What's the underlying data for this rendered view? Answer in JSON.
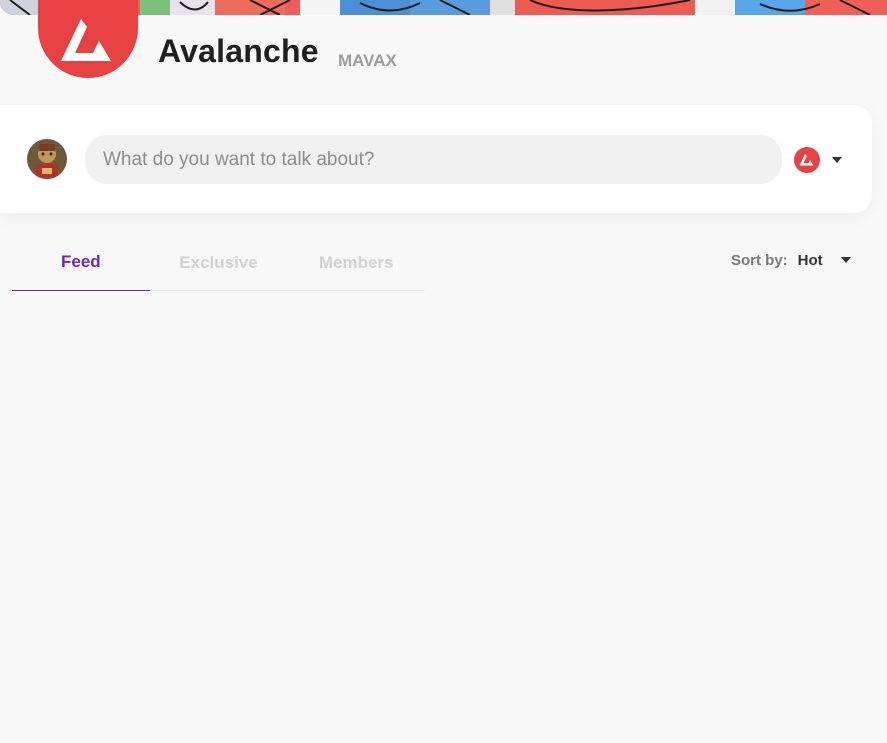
{
  "community": {
    "name": "Avalanche",
    "ticker": "MAVAX",
    "brand_color": "#e84142"
  },
  "composer": {
    "placeholder": "What do you want to talk about?",
    "avatar_icon": "user-avatar"
  },
  "tabs": [
    {
      "label": "Feed",
      "active": true
    },
    {
      "label": "Exclusive",
      "active": false
    },
    {
      "label": "Members",
      "active": false
    }
  ],
  "sort": {
    "label": "Sort by:",
    "value": "Hot"
  },
  "colors": {
    "accent": "#6a28c9",
    "background": "#f8f8f9"
  }
}
